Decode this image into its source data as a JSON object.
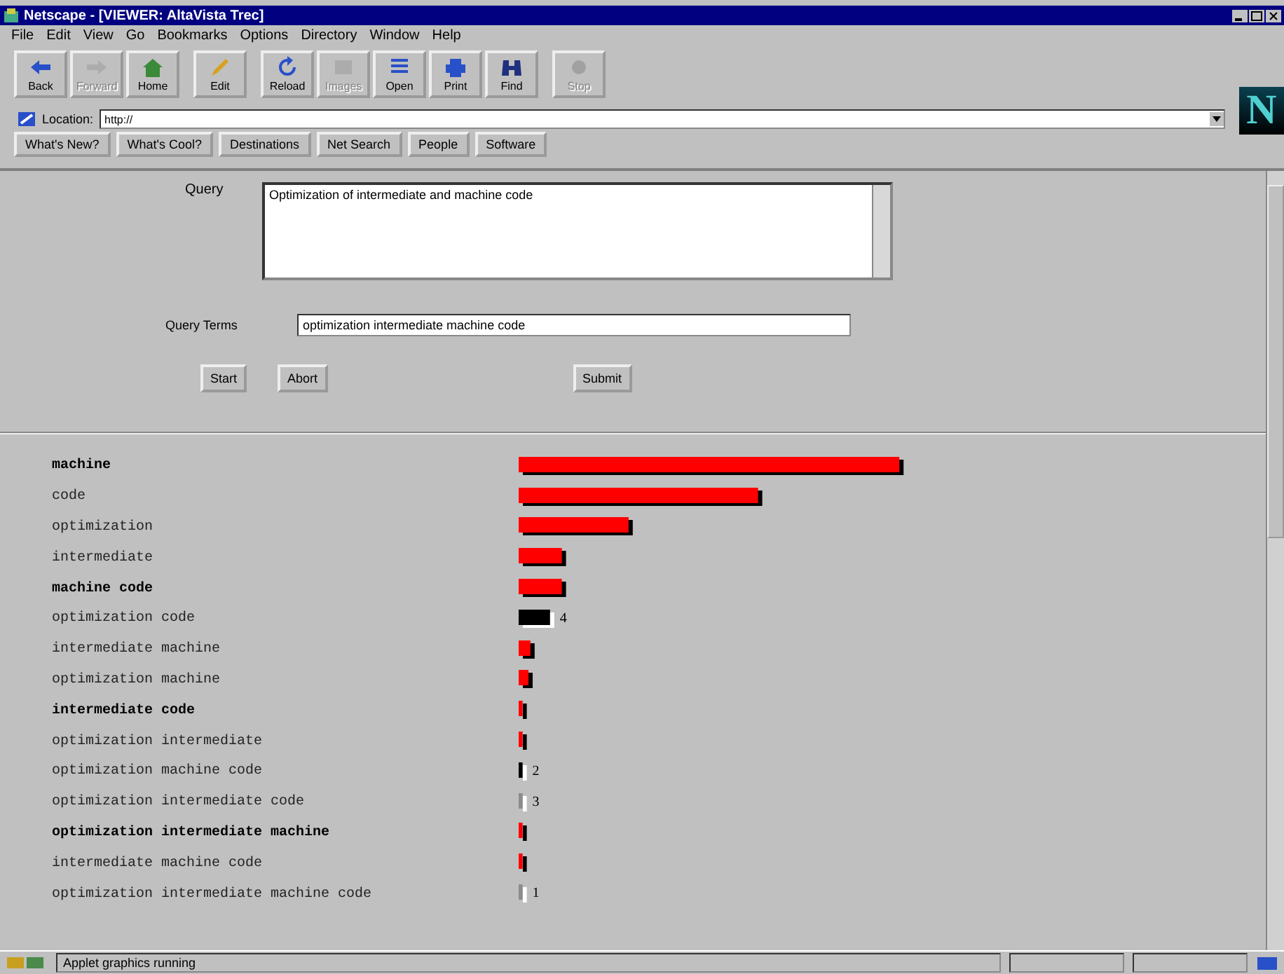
{
  "window": {
    "title": "Netscape - [VIEWER: AltaVista Trec]"
  },
  "menu": [
    "File",
    "Edit",
    "View",
    "Go",
    "Bookmarks",
    "Options",
    "Directory",
    "Window",
    "Help"
  ],
  "toolbar": [
    {
      "label": "Back",
      "disabled": false
    },
    {
      "label": "Forward",
      "disabled": true
    },
    {
      "label": "Home",
      "disabled": false
    },
    {
      "label": "Edit",
      "disabled": false
    },
    {
      "label": "Reload",
      "disabled": false
    },
    {
      "label": "Images",
      "disabled": true
    },
    {
      "label": "Open",
      "disabled": false
    },
    {
      "label": "Print",
      "disabled": false
    },
    {
      "label": "Find",
      "disabled": false
    },
    {
      "label": "Stop",
      "disabled": true
    }
  ],
  "location": {
    "label": "Location:",
    "value": "http://"
  },
  "logo": "N",
  "directory_buttons": [
    "What's New?",
    "What's Cool?",
    "Destinations",
    "Net Search",
    "People",
    "Software"
  ],
  "form": {
    "query_label": "Query",
    "query": "Optimization of intermediate and machine code",
    "terms_label": "Query Terms",
    "terms": "optimization intermediate machine code",
    "buttons": [
      "Start",
      "Abort",
      "Submit"
    ]
  },
  "terms": [
    {
      "term": "machine",
      "bold": true,
      "kind": "red",
      "level": 0.97
    },
    {
      "term": "code",
      "bold": false,
      "kind": "red",
      "level": 0.61
    },
    {
      "term": "optimization",
      "bold": false,
      "kind": "red",
      "level": 0.28
    },
    {
      "term": "intermediate",
      "bold": false,
      "kind": "red",
      "level": 0.11
    },
    {
      "term": "machine code",
      "bold": true,
      "kind": "red",
      "level": 0.11
    },
    {
      "term": "optimization code",
      "bold": false,
      "kind": "black",
      "level": 0.08,
      "count": "4"
    },
    {
      "term": "intermediate machine",
      "bold": false,
      "kind": "red",
      "level": 0.03
    },
    {
      "term": "optimization machine",
      "bold": false,
      "kind": "red",
      "level": 0.025
    },
    {
      "term": "intermediate code",
      "bold": true,
      "kind": "red",
      "level": 0.01
    },
    {
      "term": "optimization intermediate",
      "bold": false,
      "kind": "red",
      "level": 0.01
    },
    {
      "term": "optimization machine code",
      "bold": false,
      "kind": "black",
      "level": 0.01,
      "count": "2"
    },
    {
      "term": "optimization intermediate code",
      "bold": false,
      "kind": "grey",
      "level": 0.01,
      "count": "3"
    },
    {
      "term": "optimization intermediate machine",
      "bold": true,
      "kind": "red",
      "level": 0.01
    },
    {
      "term": "intermediate machine code",
      "bold": false,
      "kind": "red",
      "level": 0.01
    },
    {
      "term": "optimization intermediate machine code",
      "bold": false,
      "kind": "grey",
      "level": 0.01,
      "count": "1"
    }
  ],
  "status_bar": {
    "text": "Applet graphics running"
  }
}
